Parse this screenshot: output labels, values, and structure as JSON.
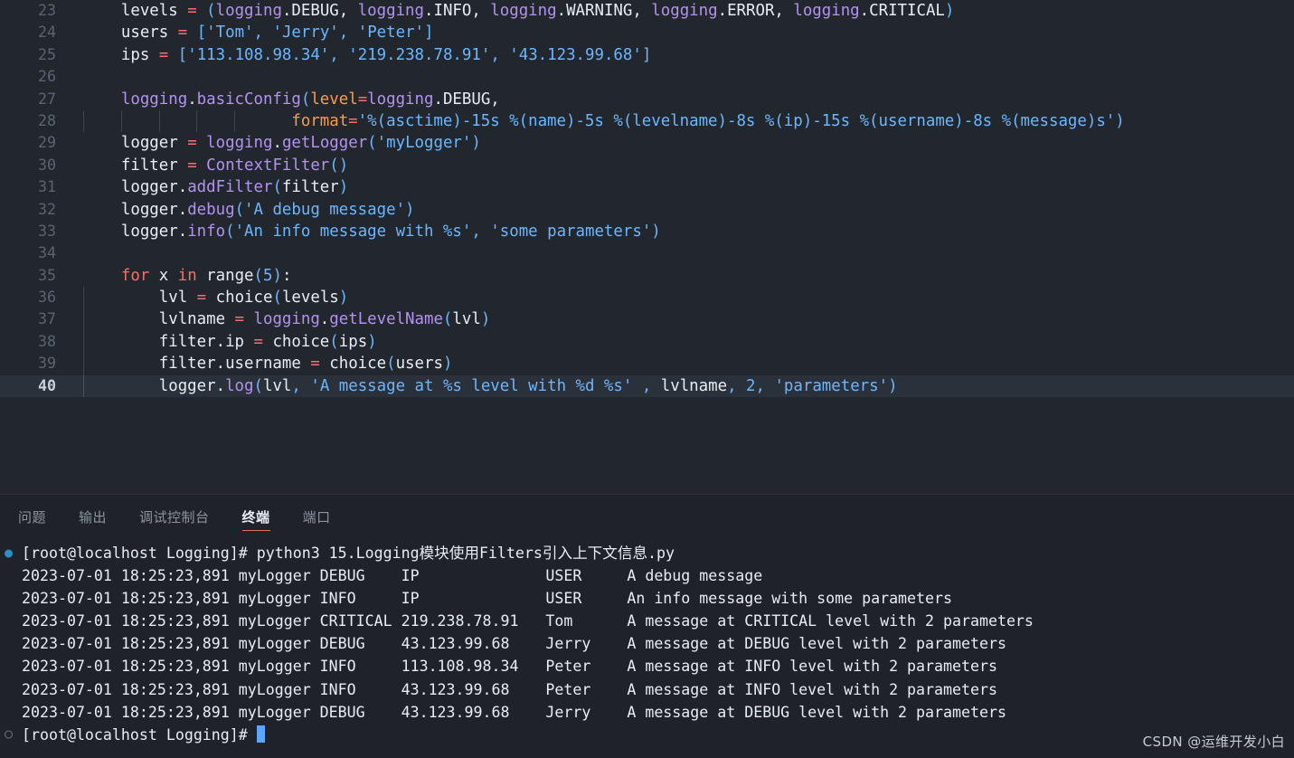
{
  "editor": {
    "active_line": 40,
    "lines": [
      {
        "no": 23,
        "tokens": [
          {
            "t": "    ",
            "c": "t-plain"
          },
          {
            "t": "levels ",
            "c": "t-ident"
          },
          {
            "t": "=",
            "c": "t-op"
          },
          {
            "t": " ",
            "c": "t-plain"
          },
          {
            "t": "(",
            "c": "t-punc"
          },
          {
            "t": "logging",
            "c": "t-mod"
          },
          {
            "t": ".DEBUG, ",
            "c": "t-attr"
          },
          {
            "t": "logging",
            "c": "t-mod"
          },
          {
            "t": ".INFO, ",
            "c": "t-attr"
          },
          {
            "t": "logging",
            "c": "t-mod"
          },
          {
            "t": ".WARNING, ",
            "c": "t-attr"
          },
          {
            "t": "logging",
            "c": "t-mod"
          },
          {
            "t": ".ERROR, ",
            "c": "t-attr"
          },
          {
            "t": "logging",
            "c": "t-mod"
          },
          {
            "t": ".CRITICAL",
            "c": "t-attr"
          },
          {
            "t": ")",
            "c": "t-punc"
          }
        ]
      },
      {
        "no": 24,
        "tokens": [
          {
            "t": "    ",
            "c": "t-plain"
          },
          {
            "t": "users ",
            "c": "t-ident"
          },
          {
            "t": "=",
            "c": "t-op"
          },
          {
            "t": " ",
            "c": "t-plain"
          },
          {
            "t": "[",
            "c": "t-punc"
          },
          {
            "t": "'Tom'",
            "c": "t-str"
          },
          {
            "t": ", ",
            "c": "t-punc"
          },
          {
            "t": "'Jerry'",
            "c": "t-str"
          },
          {
            "t": ", ",
            "c": "t-punc"
          },
          {
            "t": "'Peter'",
            "c": "t-str"
          },
          {
            "t": "]",
            "c": "t-punc"
          }
        ]
      },
      {
        "no": 25,
        "tokens": [
          {
            "t": "    ",
            "c": "t-plain"
          },
          {
            "t": "ips ",
            "c": "t-ident"
          },
          {
            "t": "=",
            "c": "t-op"
          },
          {
            "t": " ",
            "c": "t-plain"
          },
          {
            "t": "[",
            "c": "t-punc"
          },
          {
            "t": "'113.108.98.34'",
            "c": "t-str"
          },
          {
            "t": ", ",
            "c": "t-punc"
          },
          {
            "t": "'219.238.78.91'",
            "c": "t-str"
          },
          {
            "t": ", ",
            "c": "t-punc"
          },
          {
            "t": "'43.123.99.68'",
            "c": "t-str"
          },
          {
            "t": "]",
            "c": "t-punc"
          }
        ]
      },
      {
        "no": 26,
        "tokens": []
      },
      {
        "no": 27,
        "tokens": [
          {
            "t": "    ",
            "c": "t-plain"
          },
          {
            "t": "logging",
            "c": "t-mod"
          },
          {
            "t": ".",
            "c": "t-attr"
          },
          {
            "t": "basicConfig",
            "c": "t-func"
          },
          {
            "t": "(",
            "c": "t-punc"
          },
          {
            "t": "level",
            "c": "t-named"
          },
          {
            "t": "=",
            "c": "t-op"
          },
          {
            "t": "logging",
            "c": "t-mod"
          },
          {
            "t": ".DEBUG,",
            "c": "t-attr"
          }
        ]
      },
      {
        "no": 28,
        "tokens": [
          {
            "t": "                      ",
            "c": "t-plain"
          },
          {
            "t": "format",
            "c": "t-named"
          },
          {
            "t": "=",
            "c": "t-op"
          },
          {
            "t": "'%(asctime)-15s %(name)-5s %(levelname)-8s %(ip)-15s %(username)-8s %(message)s'",
            "c": "t-str"
          },
          {
            "t": ")",
            "c": "t-punc"
          }
        ],
        "guides": [
          1,
          2,
          3,
          4,
          5
        ]
      },
      {
        "no": 29,
        "tokens": [
          {
            "t": "    ",
            "c": "t-plain"
          },
          {
            "t": "logger ",
            "c": "t-ident"
          },
          {
            "t": "=",
            "c": "t-op"
          },
          {
            "t": " ",
            "c": "t-plain"
          },
          {
            "t": "logging",
            "c": "t-mod"
          },
          {
            "t": ".",
            "c": "t-attr"
          },
          {
            "t": "getLogger",
            "c": "t-func"
          },
          {
            "t": "(",
            "c": "t-punc"
          },
          {
            "t": "'myLogger'",
            "c": "t-str"
          },
          {
            "t": ")",
            "c": "t-punc"
          }
        ]
      },
      {
        "no": 30,
        "tokens": [
          {
            "t": "    ",
            "c": "t-plain"
          },
          {
            "t": "filter ",
            "c": "t-ident"
          },
          {
            "t": "=",
            "c": "t-op"
          },
          {
            "t": " ",
            "c": "t-plain"
          },
          {
            "t": "ContextFilter",
            "c": "t-func"
          },
          {
            "t": "()",
            "c": "t-punc"
          }
        ]
      },
      {
        "no": 31,
        "tokens": [
          {
            "t": "    ",
            "c": "t-plain"
          },
          {
            "t": "logger",
            "c": "t-ident"
          },
          {
            "t": ".",
            "c": "t-attr"
          },
          {
            "t": "addFilter",
            "c": "t-func"
          },
          {
            "t": "(",
            "c": "t-punc"
          },
          {
            "t": "filter",
            "c": "t-ident"
          },
          {
            "t": ")",
            "c": "t-punc"
          }
        ]
      },
      {
        "no": 32,
        "tokens": [
          {
            "t": "    ",
            "c": "t-plain"
          },
          {
            "t": "logger",
            "c": "t-ident"
          },
          {
            "t": ".",
            "c": "t-attr"
          },
          {
            "t": "debug",
            "c": "t-func"
          },
          {
            "t": "(",
            "c": "t-punc"
          },
          {
            "t": "'A debug message'",
            "c": "t-str"
          },
          {
            "t": ")",
            "c": "t-punc"
          }
        ]
      },
      {
        "no": 33,
        "tokens": [
          {
            "t": "    ",
            "c": "t-plain"
          },
          {
            "t": "logger",
            "c": "t-ident"
          },
          {
            "t": ".",
            "c": "t-attr"
          },
          {
            "t": "info",
            "c": "t-func"
          },
          {
            "t": "(",
            "c": "t-punc"
          },
          {
            "t": "'An info message with %s'",
            "c": "t-str"
          },
          {
            "t": ", ",
            "c": "t-punc"
          },
          {
            "t": "'some parameters'",
            "c": "t-str"
          },
          {
            "t": ")",
            "c": "t-punc"
          }
        ]
      },
      {
        "no": 34,
        "tokens": []
      },
      {
        "no": 35,
        "tokens": [
          {
            "t": "    ",
            "c": "t-plain"
          },
          {
            "t": "for",
            "c": "t-kw"
          },
          {
            "t": " x ",
            "c": "t-ident"
          },
          {
            "t": "in",
            "c": "t-kw"
          },
          {
            "t": " ",
            "c": "t-plain"
          },
          {
            "t": "range",
            "c": "t-ident"
          },
          {
            "t": "(",
            "c": "t-punc"
          },
          {
            "t": "5",
            "c": "t-num"
          },
          {
            "t": ")",
            "c": "t-punc"
          },
          {
            "t": ":",
            "c": "t-attr"
          }
        ]
      },
      {
        "no": 36,
        "tokens": [
          {
            "t": "        ",
            "c": "t-plain"
          },
          {
            "t": "lvl ",
            "c": "t-ident"
          },
          {
            "t": "=",
            "c": "t-op"
          },
          {
            "t": " ",
            "c": "t-plain"
          },
          {
            "t": "choice",
            "c": "t-ident"
          },
          {
            "t": "(",
            "c": "t-punc"
          },
          {
            "t": "levels",
            "c": "t-ident"
          },
          {
            "t": ")",
            "c": "t-punc"
          }
        ],
        "guides": [
          1
        ]
      },
      {
        "no": 37,
        "tokens": [
          {
            "t": "        ",
            "c": "t-plain"
          },
          {
            "t": "lvlname ",
            "c": "t-ident"
          },
          {
            "t": "=",
            "c": "t-op"
          },
          {
            "t": " ",
            "c": "t-plain"
          },
          {
            "t": "logging",
            "c": "t-mod"
          },
          {
            "t": ".",
            "c": "t-attr"
          },
          {
            "t": "getLevelName",
            "c": "t-func"
          },
          {
            "t": "(",
            "c": "t-punc"
          },
          {
            "t": "lvl",
            "c": "t-ident"
          },
          {
            "t": ")",
            "c": "t-punc"
          }
        ],
        "guides": [
          1
        ]
      },
      {
        "no": 38,
        "tokens": [
          {
            "t": "        ",
            "c": "t-plain"
          },
          {
            "t": "filter",
            "c": "t-ident"
          },
          {
            "t": ".ip ",
            "c": "t-attr"
          },
          {
            "t": "=",
            "c": "t-op"
          },
          {
            "t": " ",
            "c": "t-plain"
          },
          {
            "t": "choice",
            "c": "t-ident"
          },
          {
            "t": "(",
            "c": "t-punc"
          },
          {
            "t": "ips",
            "c": "t-ident"
          },
          {
            "t": ")",
            "c": "t-punc"
          }
        ],
        "guides": [
          1
        ]
      },
      {
        "no": 39,
        "tokens": [
          {
            "t": "        ",
            "c": "t-plain"
          },
          {
            "t": "filter",
            "c": "t-ident"
          },
          {
            "t": ".username ",
            "c": "t-attr"
          },
          {
            "t": "=",
            "c": "t-op"
          },
          {
            "t": " ",
            "c": "t-plain"
          },
          {
            "t": "choice",
            "c": "t-ident"
          },
          {
            "t": "(",
            "c": "t-punc"
          },
          {
            "t": "users",
            "c": "t-ident"
          },
          {
            "t": ")",
            "c": "t-punc"
          }
        ],
        "guides": [
          1
        ]
      },
      {
        "no": 40,
        "tokens": [
          {
            "t": "        ",
            "c": "t-plain"
          },
          {
            "t": "logger",
            "c": "t-ident"
          },
          {
            "t": ".",
            "c": "t-attr"
          },
          {
            "t": "log",
            "c": "t-func"
          },
          {
            "t": "(",
            "c": "t-punc"
          },
          {
            "t": "lvl",
            "c": "t-ident"
          },
          {
            "t": ", ",
            "c": "t-punc"
          },
          {
            "t": "'A message at %s level with %d %s'",
            "c": "t-str"
          },
          {
            "t": " , ",
            "c": "t-punc"
          },
          {
            "t": "lvlname",
            "c": "t-ident"
          },
          {
            "t": ", ",
            "c": "t-punc"
          },
          {
            "t": "2",
            "c": "t-num"
          },
          {
            "t": ", ",
            "c": "t-punc"
          },
          {
            "t": "'parameters'",
            "c": "t-str"
          },
          {
            "t": ")",
            "c": "t-punc"
          }
        ],
        "guides": [
          1
        ]
      }
    ]
  },
  "panel": {
    "tabs": [
      {
        "label": "问题",
        "active": false
      },
      {
        "label": "输出",
        "active": false
      },
      {
        "label": "调试控制台",
        "active": false
      },
      {
        "label": "终端",
        "active": true
      },
      {
        "label": "端口",
        "active": false
      }
    ],
    "accent_color": "#e0734d"
  },
  "terminal": {
    "lines": [
      {
        "marker": "run",
        "text": "[root@localhost Logging]# python3 15.Logging模块使用Filters引入上下文信息.py"
      },
      {
        "marker": "none",
        "text": "2023-07-01 18:25:23,891 myLogger DEBUG    IP              USER     A debug message"
      },
      {
        "marker": "none",
        "text": "2023-07-01 18:25:23,891 myLogger INFO     IP              USER     An info message with some parameters"
      },
      {
        "marker": "none",
        "text": "2023-07-01 18:25:23,891 myLogger CRITICAL 219.238.78.91   Tom      A message at CRITICAL level with 2 parameters"
      },
      {
        "marker": "none",
        "text": "2023-07-01 18:25:23,891 myLogger DEBUG    43.123.99.68    Jerry    A message at DEBUG level with 2 parameters"
      },
      {
        "marker": "none",
        "text": "2023-07-01 18:25:23,891 myLogger INFO     113.108.98.34   Peter    A message at INFO level with 2 parameters"
      },
      {
        "marker": "none",
        "text": "2023-07-01 18:25:23,891 myLogger INFO     43.123.99.68    Peter    A message at INFO level with 2 parameters"
      },
      {
        "marker": "none",
        "text": "2023-07-01 18:25:23,891 myLogger DEBUG    43.123.99.68    Jerry    A message at DEBUG level with 2 parameters"
      },
      {
        "marker": "idle",
        "text": "[root@localhost Logging]# ",
        "cursor": true
      }
    ]
  },
  "watermark": {
    "text": "CSDN @运维开发小白"
  }
}
